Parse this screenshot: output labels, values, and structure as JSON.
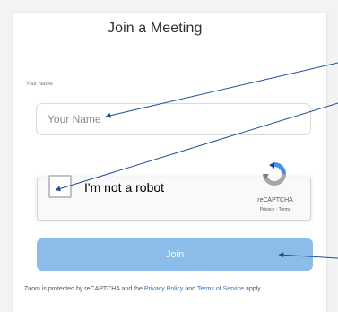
{
  "page": {
    "title": "Join a Meeting"
  },
  "name_field": {
    "label": "Your Name",
    "placeholder": "Your Name",
    "value": ""
  },
  "recaptcha": {
    "checkbox_label": "I'm not a robot",
    "brand": "reCAPTCHA",
    "privacy_link": "Privacy",
    "separator": " - ",
    "terms_link": "Terms",
    "checked": false
  },
  "join_button": {
    "label": "Join",
    "color": "#8bbde8"
  },
  "footer": {
    "prefix": "Zoom is protected by reCAPTCHA and the ",
    "privacy_policy": "Privacy Policy",
    "and": " and ",
    "terms_of_service": "Terms of Service",
    "suffix": " apply."
  },
  "colors": {
    "link": "#2d74c4",
    "annotation_arrow": "#1f4e9a"
  }
}
